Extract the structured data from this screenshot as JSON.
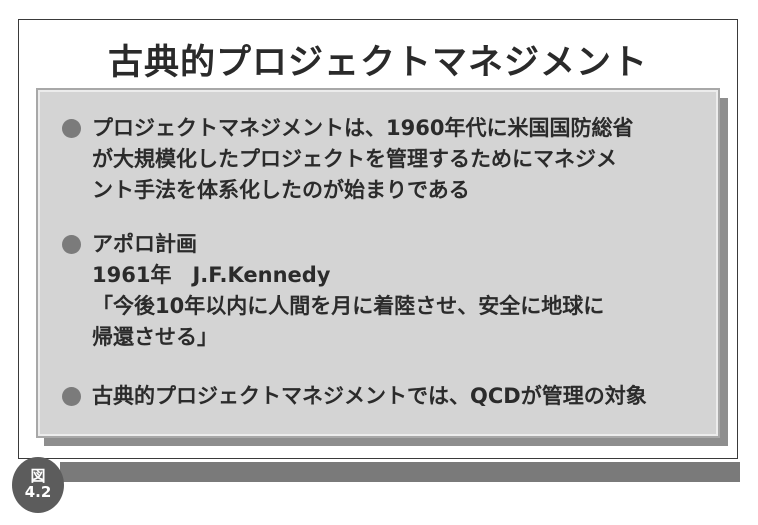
{
  "slide": {
    "title": "古典的プロジェクトマネジメント"
  },
  "bullets": [
    {
      "lines": [
        "プロジェクトマネジメントは、1960年代に米国国防総省",
        "が大規模化したプロジェクトを管理するためにマネジメ",
        "ント手法を体系化したのが始まりである"
      ]
    },
    {
      "lines": [
        "アポロ計画",
        "1961年　J.F.Kennedy",
        "「今後10年以内に人間を月に着陸させ、安全に地球に",
        "帰還させる」"
      ]
    },
    {
      "lines": [
        "古典的プロジェクトマネジメントでは、QCDが管理の対象"
      ]
    }
  ],
  "figure_badge": {
    "label": "図",
    "number": "4.2"
  }
}
